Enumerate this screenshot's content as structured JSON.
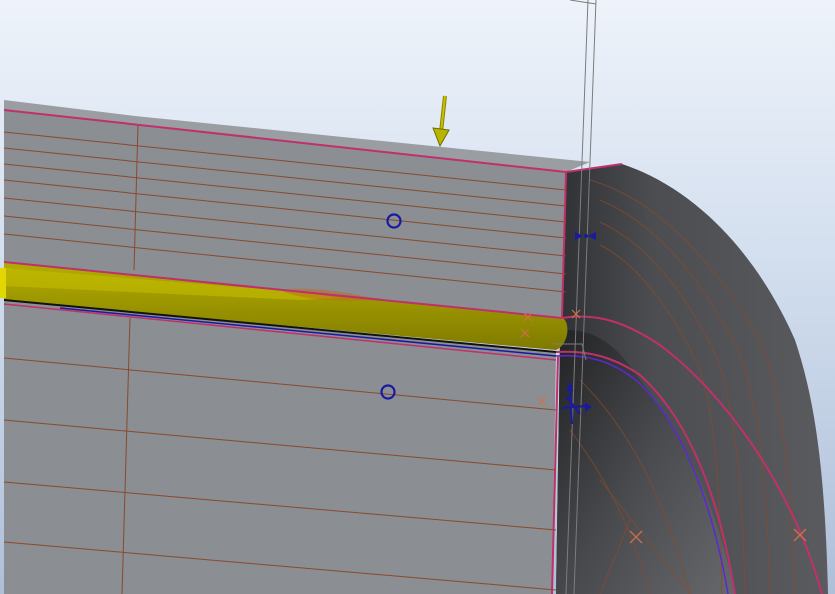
{
  "scene": {
    "colors": {
      "face_gray": "#8b8e93",
      "face_gray_light": "#9a9da2",
      "face_dark": "#4a4b4e",
      "face_darker": "#2e2f31",
      "edge_magenta": "#c0306a",
      "edge_brown": "#8a4a2e",
      "highlight_yellow": "#9a9400",
      "highlight_yellow_bright": "#c8c000",
      "arrow_yellow": "#b8b400",
      "datum_blue": "#1a1aa0",
      "datum_line": "#7c7c7c",
      "purple_edge": "#5a2ad0",
      "orange_cross": "#d0704a"
    },
    "icons": {
      "arrow": "direction-arrow-icon",
      "point": "datum-point-icon",
      "axis": "coordinate-system-icon",
      "cross": "datum-cross-icon"
    }
  }
}
